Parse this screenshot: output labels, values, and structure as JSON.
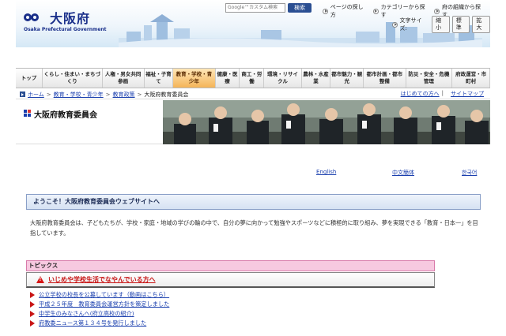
{
  "header": {
    "logo_title": "大阪府",
    "logo_subtitle": "Osaka Prefectural Government",
    "search_placeholder": "Google™カスタム検索",
    "search_button": "検索",
    "top_links": [
      "ページの探し方",
      "カテゴリーから探す",
      "府の組織から探す"
    ],
    "font_size_label": "文字サイズ:",
    "font_size_buttons": [
      "縮小",
      "標準",
      "拡大"
    ]
  },
  "nav": {
    "items": [
      "トップ",
      "くらし・住まい・まちづくり",
      "人権・男女共同参画",
      "福祉・子育て",
      "教育・学校・青少年",
      "健康・医療",
      "商工・労働",
      "環境・リサイクル",
      "農林・水産業",
      "都市魅力・観光",
      "都市計画・都市整備",
      "防災・安全・危機管理",
      "府政運営・市町村"
    ],
    "active_index": 4
  },
  "breadcrumb": {
    "items": [
      "ホーム",
      "教育・学校・青少年",
      "教育政策",
      "大阪府教育委員会"
    ],
    "right_links": [
      "はじめての方へ",
      "サイトマップ"
    ]
  },
  "banner": {
    "title": "大阪府教育委員会"
  },
  "languages": [
    "English",
    "中文簡体",
    "한국어"
  ],
  "welcome": {
    "heading": "ようこそ！大阪府教育委員会ウェブサイトへ",
    "intro": "大阪府教育委員会は、子どもたちが、学校・家庭・地域の学びの輪の中で、自分の夢に向かって勉強やスポーツなどに積極的に取り組み、夢を実現できる「教育・日本一」を目指しています。"
  },
  "topics": {
    "header": "トピックス",
    "alert": "いじめや学校生活でなやんでいる方へ",
    "items": [
      "公立学校の校長を公募しています（動画はこちら）",
      "平成２５年度　教育委員会運営方針を策定しました",
      "中学生のみなさんへ(府立高校の紹介)",
      "府教委ニュース第１３４号を発行しました"
    ]
  },
  "colors": {
    "brand_blue": "#1a2f8a",
    "link_blue": "#1a3fae",
    "active_nav": "#f4b458",
    "alert_red": "#c81414",
    "topics_pink": "#f7c9e0"
  }
}
